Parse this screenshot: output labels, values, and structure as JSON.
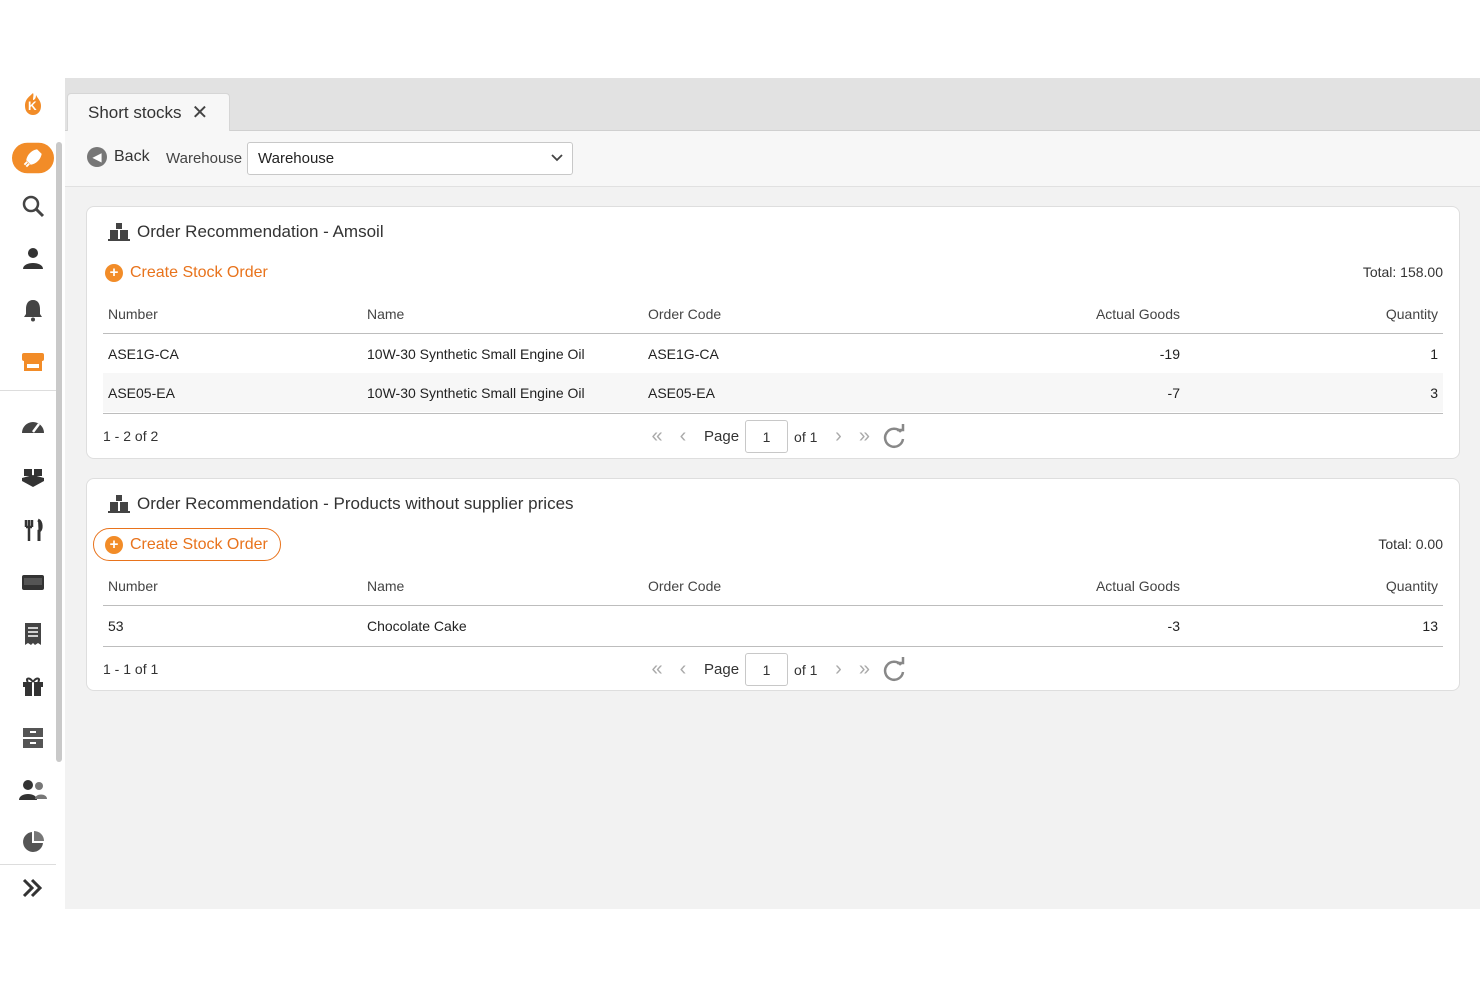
{
  "tab": {
    "label": "Short stocks"
  },
  "toolbar": {
    "back_label": "Back",
    "warehouse_label": "Warehouse",
    "warehouse_value": "Warehouse"
  },
  "cards": [
    {
      "title": "Order Recommendation - Amsoil",
      "create_label": "Create Stock Order",
      "total": "Total: 158.00",
      "columns": [
        "Number",
        "Name",
        "Order Code",
        "Actual Goods",
        "Quantity"
      ],
      "rows": [
        [
          "ASE1G-CA",
          "10W-30 Synthetic Small Engine Oil",
          "ASE1G-CA",
          "-19",
          "1"
        ],
        [
          "ASE05-EA",
          "10W-30 Synthetic Small Engine Oil",
          "ASE05-EA",
          "-7",
          "3"
        ]
      ],
      "range": "1 - 2 of 2",
      "pager": {
        "page_label": "Page",
        "page_value": "1",
        "of_label": "of 1"
      }
    },
    {
      "title": "Order Recommendation - Products without supplier prices",
      "create_label": "Create Stock Order",
      "total": "Total: 0.00",
      "columns": [
        "Number",
        "Name",
        "Order Code",
        "Actual Goods",
        "Quantity"
      ],
      "rows": [
        [
          "53",
          "Chocolate Cake",
          "",
          "-3",
          "13"
        ]
      ],
      "range": "1 - 1 of 1",
      "pager": {
        "page_label": "Page",
        "page_value": "1",
        "of_label": "of 1"
      }
    }
  ],
  "sidebar": {
    "icons": [
      "logo-icon",
      "rocket-icon",
      "search-icon",
      "user-icon",
      "bell-icon",
      "store-icon",
      "dashboard-icon",
      "boxes-icon",
      "cutlery-icon",
      "card-icon",
      "receipt-icon",
      "gift-icon",
      "archive-icon",
      "users-icon",
      "pie-chart-icon",
      "expand-icon"
    ],
    "accent": "#f28c28"
  },
  "colors": {
    "accent": "#e8731c",
    "background": "#f2f2f2"
  }
}
